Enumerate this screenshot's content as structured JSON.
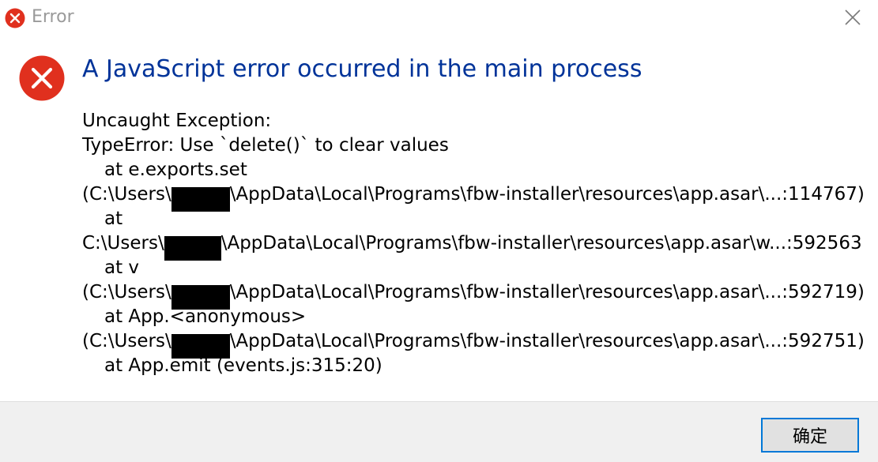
{
  "window": {
    "title": "Error",
    "icon": "error-icon",
    "close_icon": "close-icon"
  },
  "main": {
    "instruction": "A JavaScript error occurred in the main process",
    "lines": {
      "l0": "Uncaught Exception:",
      "l1": "TypeError: Use `delete()` to clear values",
      "l2": "at e.exports.set",
      "l3a": "(C:\\Users\\",
      "l3b": "\\AppData\\Local\\Programs\\fbw-installer\\resources\\app.asar\\...:114767)",
      "l4": "at",
      "l5a": "C:\\Users\\",
      "l5b": "\\AppData\\Local\\Programs\\fbw-installer\\resources\\app.asar\\w...:592563",
      "l6": "at v",
      "l7a": "(C:\\Users\\",
      "l7b": "\\AppData\\Local\\Programs\\fbw-installer\\resources\\app.asar\\...:592719)",
      "l8": "at App.<anonymous>",
      "l9a": "(C:\\Users\\",
      "l9b": "\\AppData\\Local\\Programs\\fbw-installer\\resources\\app.asar\\...:592751)",
      "l10": "at App.emit (events.js:315:20)"
    }
  },
  "footer": {
    "ok_label": "确定"
  },
  "colors": {
    "instruction": "#003399",
    "error_red": "#e0301e",
    "button_border": "#0078d7",
    "footer_bg": "#f0f0f0"
  }
}
